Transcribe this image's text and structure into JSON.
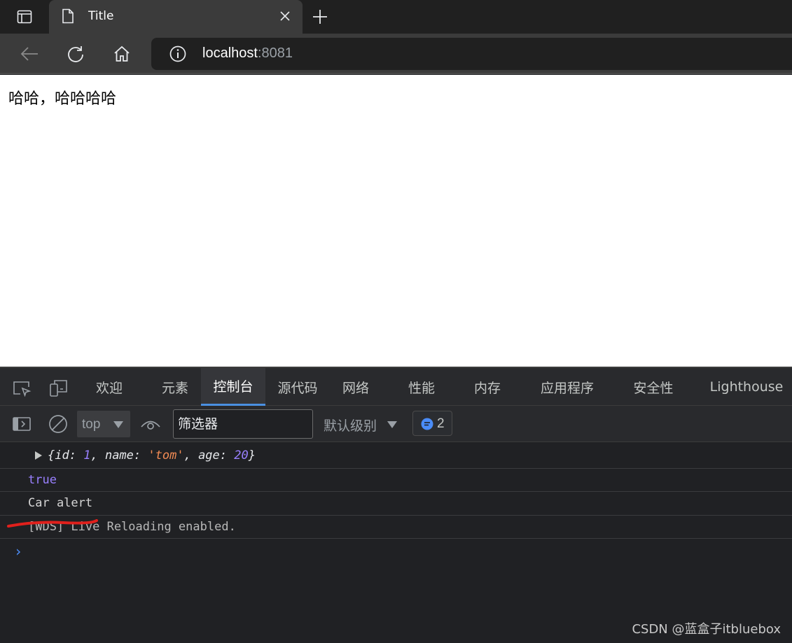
{
  "browser": {
    "tab": {
      "title": "Title"
    },
    "address": {
      "host": "localhost",
      "port": ":8081"
    }
  },
  "page": {
    "text": "哈哈，哈哈哈哈"
  },
  "devtools": {
    "tabs": [
      {
        "label": "欢迎"
      },
      {
        "label": "元素"
      },
      {
        "label": "控制台"
      },
      {
        "label": "源代码"
      },
      {
        "label": "网络"
      },
      {
        "label": "性能"
      },
      {
        "label": "内存"
      },
      {
        "label": "应用程序"
      },
      {
        "label": "安全性"
      },
      {
        "label": "Lighthouse"
      }
    ],
    "active_tab": "控制台",
    "toolbar": {
      "context": "top",
      "filter_placeholder": "筛选器",
      "level": "默认级别",
      "message_count": "2"
    },
    "console": {
      "object_open": "{",
      "object_close": "}",
      "obj": {
        "k1": "id",
        "v1": "1",
        "k2": "name",
        "v2": "'tom'",
        "k3": "age",
        "v3": "20"
      },
      "row2": "true",
      "row3": "Car alert",
      "row4": "[WDS] Live Reloading enabled."
    }
  },
  "watermark": "CSDN @蓝盒子itbluebox",
  "colors": {
    "accent": "#4a90e2",
    "annotation": "#e0201c"
  }
}
